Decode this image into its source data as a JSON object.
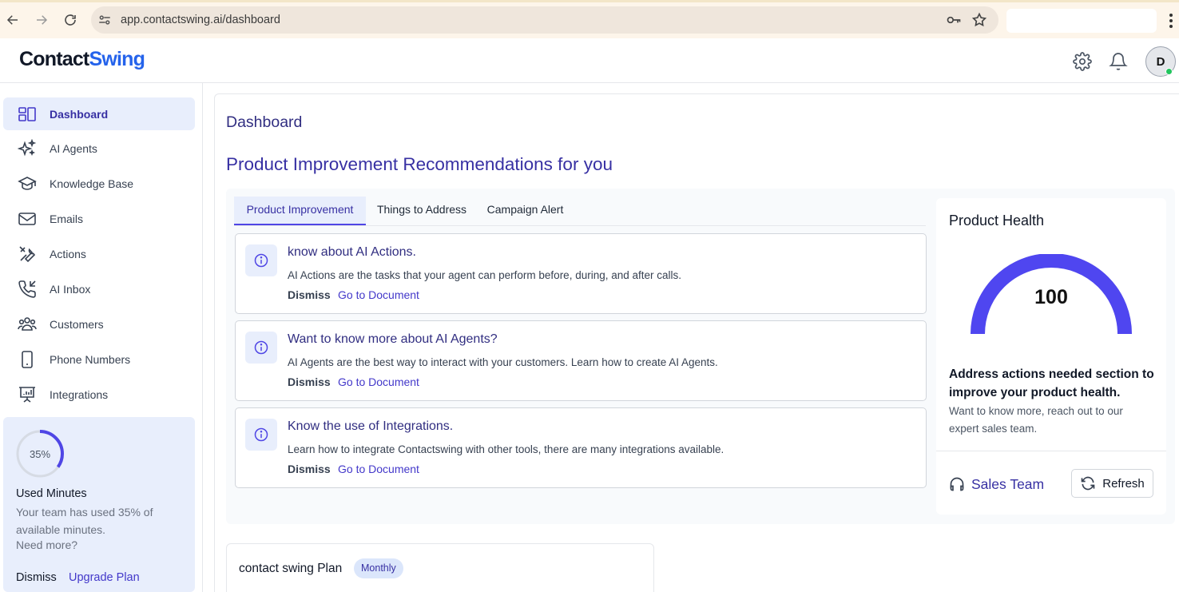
{
  "browser": {
    "url": "app.contactswing.ai/dashboard"
  },
  "header": {
    "logo_part1": "Contact",
    "logo_part2": "Swing",
    "avatar_initial": "D",
    "icons": [
      "settings-gear-icon",
      "notification-bell-icon"
    ]
  },
  "sidebar": {
    "items": [
      {
        "label": "Dashboard",
        "icon": "dashboard-icon",
        "active": true
      },
      {
        "label": "AI Agents",
        "icon": "sparkles-icon",
        "active": false
      },
      {
        "label": "Knowledge Base",
        "icon": "graduation-cap-icon",
        "active": false
      },
      {
        "label": "Emails",
        "icon": "mail-icon",
        "active": false
      },
      {
        "label": "Actions",
        "icon": "tools-icon",
        "active": false
      },
      {
        "label": "AI Inbox",
        "icon": "phone-incoming-icon",
        "active": false
      },
      {
        "label": "Customers",
        "icon": "users-icon",
        "active": false
      },
      {
        "label": "Phone Numbers",
        "icon": "mobile-phone-icon",
        "active": false
      },
      {
        "label": "Integrations",
        "icon": "presentation-chart-icon",
        "active": false
      }
    ],
    "usage": {
      "percent_label": "35%",
      "percent": 35,
      "title": "Used Minutes",
      "description": "Your team has used 35% of available minutes.",
      "need_more": "Need more?",
      "dismiss": "Dismiss",
      "upgrade": "Upgrade Plan"
    }
  },
  "main": {
    "page_title": "Dashboard",
    "section_title": "Product Improvement Recommendations for you",
    "tabs": [
      {
        "label": "Product Improvement",
        "active": true
      },
      {
        "label": "Things to Address",
        "active": false
      },
      {
        "label": "Campaign Alert",
        "active": false
      }
    ],
    "recommendations": [
      {
        "title": "know about AI Actions.",
        "description": "AI Actions are the tasks that your agent can perform before, during, and after calls.",
        "dismiss": "Dismiss",
        "link": "Go to Document"
      },
      {
        "title": "Want to know more about AI Agents?",
        "description": "AI Agents are the best way to interact with your customers. Learn how to create AI Agents.",
        "dismiss": "Dismiss",
        "link": "Go to Document"
      },
      {
        "title": "Know the use of Integrations.",
        "description": "Learn how to integrate Contactswing with other tools, there are many integrations available.",
        "dismiss": "Dismiss",
        "link": "Go to Document"
      }
    ],
    "health": {
      "title": "Product Health",
      "score": "100",
      "score_value": 100,
      "gauge_color": "#4f46f0",
      "heading": "Address actions needed section to improve your product health.",
      "description": "Want to know more, reach out to our expert sales team.",
      "sales_team": "Sales Team",
      "refresh": "Refresh"
    },
    "plan": {
      "title": "contact swing Plan",
      "badge": "Monthly"
    }
  }
}
